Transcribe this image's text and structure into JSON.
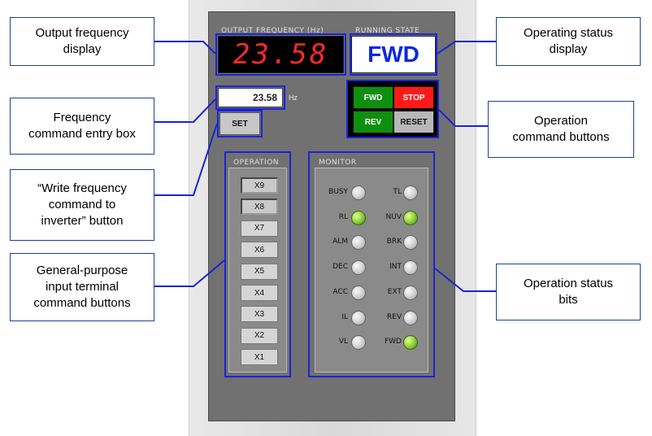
{
  "callouts": {
    "output_frequency_display": "Output frequency\ndisplay",
    "frequency_command_entry_box": "Frequency\ncommand entry box",
    "write_frequency_button": "“Write frequency\ncommand to\ninverter” button",
    "general_purpose_input": "General-purpose\ninput terminal\ncommand buttons",
    "operating_status_display": "Operating status\ndisplay",
    "operation_command_buttons": "Operation\ncommand buttons",
    "operation_status_bits": "Operation status\nbits"
  },
  "panel": {
    "output_frequency_header": "OUTPUT FREQUENCY (Hz)",
    "running_state_header": "RUNNING STATE",
    "output_frequency_value": "23.58",
    "running_state_value": "FWD",
    "frequency_entry_value": "23.58",
    "frequency_unit": "Hz",
    "set_label": "SET",
    "commands": {
      "fwd": "FWD",
      "stop": "STOP",
      "rev": "REV",
      "reset": "RESET"
    },
    "operation_header": "OPERATION",
    "monitor_header": "MONITOR",
    "x_buttons": [
      "X9",
      "X8",
      "X7",
      "X6",
      "X5",
      "X4",
      "X3",
      "X2",
      "X1"
    ],
    "x_pressed": [
      true,
      true,
      false,
      false,
      false,
      false,
      false,
      false,
      false
    ],
    "monitor_left": [
      {
        "label": "BUSY",
        "on": false
      },
      {
        "label": "RL",
        "on": true
      },
      {
        "label": "ALM",
        "on": false
      },
      {
        "label": "DEC",
        "on": false
      },
      {
        "label": "ACC",
        "on": false
      },
      {
        "label": "IL",
        "on": false
      },
      {
        "label": "VL",
        "on": false
      }
    ],
    "monitor_right": [
      {
        "label": "TL",
        "on": false
      },
      {
        "label": "NUV",
        "on": true
      },
      {
        "label": "BRK",
        "on": false
      },
      {
        "label": "INT",
        "on": false
      },
      {
        "label": "EXT",
        "on": false
      },
      {
        "label": "REV",
        "on": false
      },
      {
        "label": "FWD",
        "on": true
      }
    ]
  },
  "colors": {
    "fwd_button": "#0f8f0f",
    "rev_button": "#0f8f0f",
    "stop_button": "#ff1a1a",
    "reset_button": "#b8b8b8",
    "highlight": "#1a24d6",
    "frequency_digits": "#ff2a2a",
    "running_state_text": "#0a28e0"
  }
}
